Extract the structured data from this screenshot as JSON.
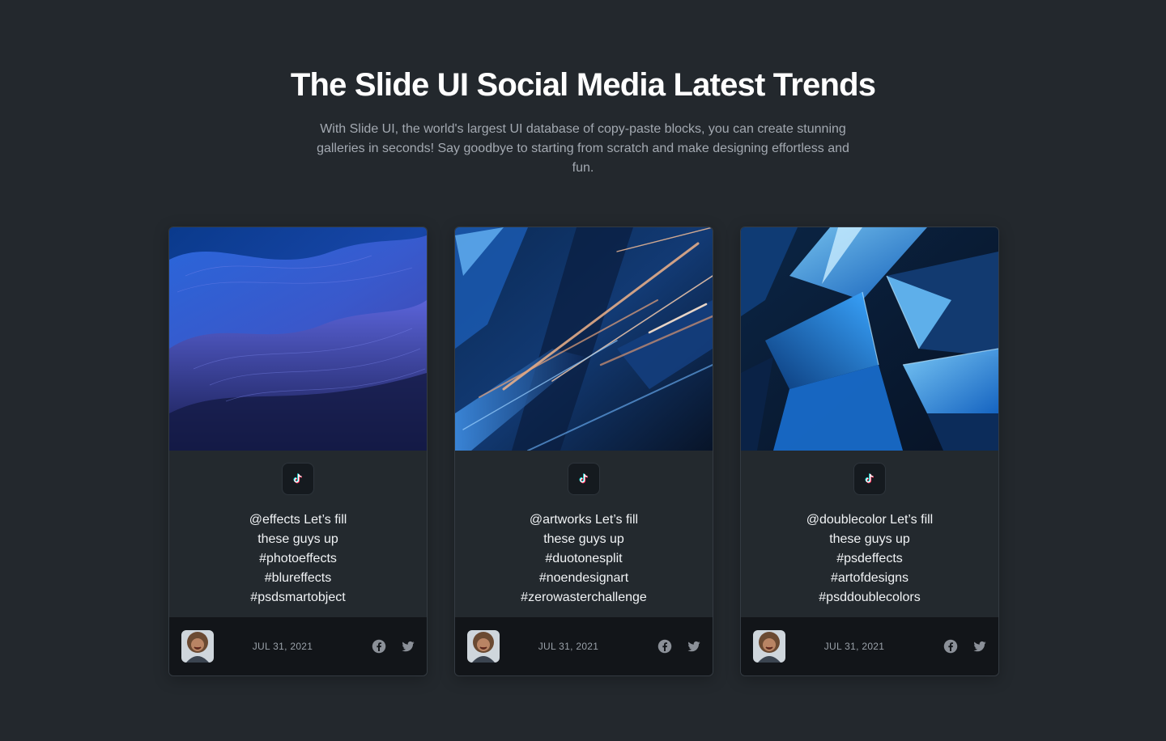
{
  "header": {
    "title": "The Slide UI Social Media Latest Trends",
    "subtitle": "With Slide UI, the world's largest UI database of copy-paste blocks, you can create stunning galleries in seconds! Say goodbye to starting from scratch and make designing effortless and fun."
  },
  "icons": {
    "platform": "tiktok-icon",
    "share": [
      "facebook-icon",
      "twitter-icon"
    ]
  },
  "colors": {
    "background": "#23282d",
    "card_footer": "#121519",
    "accent_blue": "#3a7bd5"
  },
  "cards": [
    {
      "caption_lines": [
        "@effects Let’s fill",
        "these guys up",
        "#photoeffects",
        "#blureffects",
        "#psdsmartobject"
      ],
      "date": "JUL 31, 2021"
    },
    {
      "caption_lines": [
        "@artworks Let’s fill",
        "these guys up",
        "#duotonesplit",
        "#noendesignart",
        "#zerowasterchallenge"
      ],
      "date": "JUL 31, 2021"
    },
    {
      "caption_lines": [
        "@doublecolor Let’s fill",
        "these guys up",
        "#psdeffects",
        "#artofdesigns",
        "#psddoublecolors"
      ],
      "date": "JUL 31, 2021"
    }
  ]
}
